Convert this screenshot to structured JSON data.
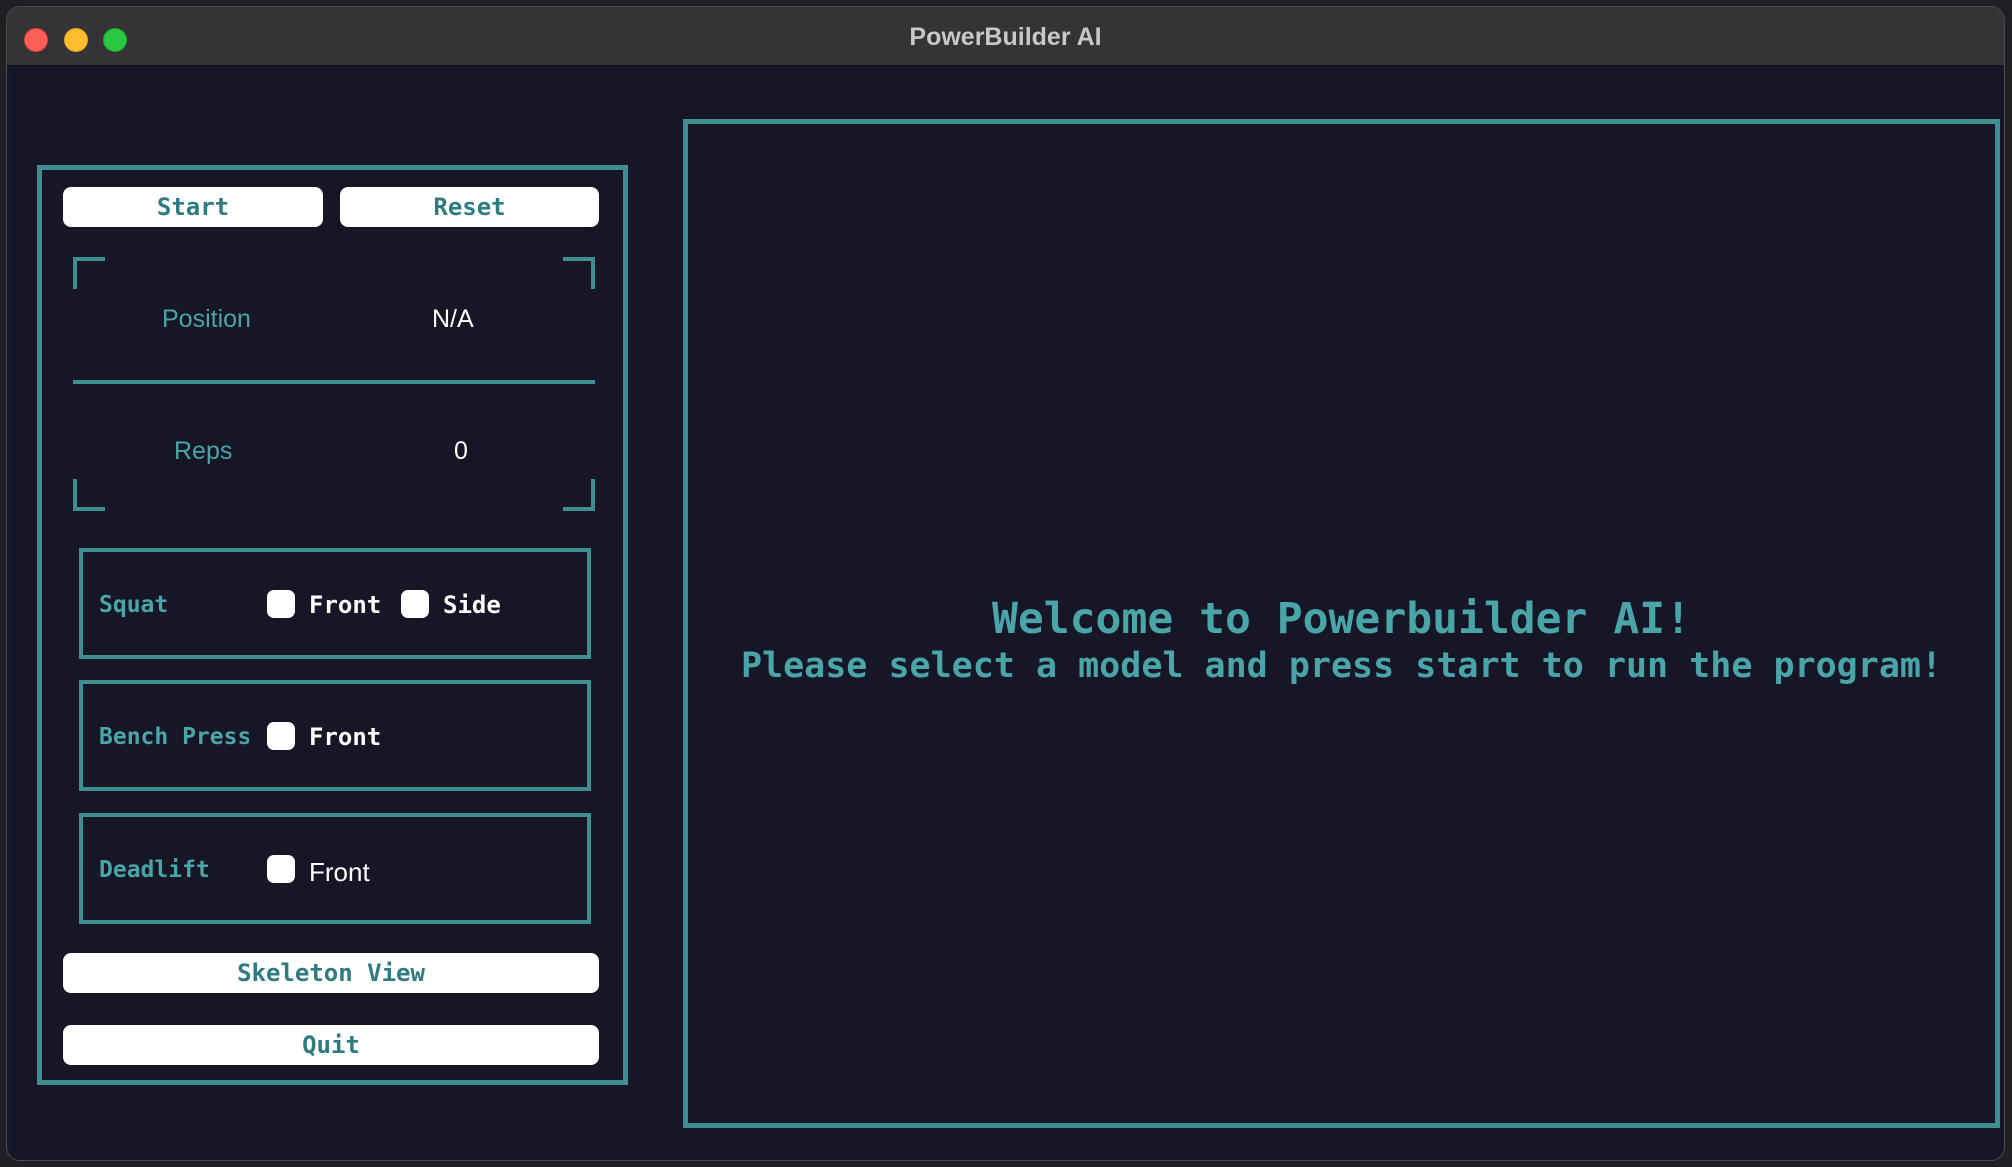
{
  "window": {
    "title": "PowerBuilder AI"
  },
  "controls": {
    "start_label": "Start",
    "reset_label": "Reset",
    "skeleton_label": "Skeleton View",
    "quit_label": "Quit"
  },
  "stats": {
    "position_label": "Position",
    "position_value": "N/A",
    "reps_label": "Reps",
    "reps_value": "0"
  },
  "exercises": {
    "squat": {
      "label": "Squat",
      "front_label": "Front",
      "side_label": "Side",
      "front_checked": false,
      "side_checked": false
    },
    "bench": {
      "label": "Bench Press",
      "front_label": "Front",
      "front_checked": false
    },
    "deadlift": {
      "label": "Deadlift",
      "front_label": "Front",
      "front_checked": false
    }
  },
  "viewport": {
    "heading": "Welcome to Powerbuilder AI!",
    "subheading": "Please select a model and press start to run the program!"
  },
  "colors": {
    "accent": "#3f8f92",
    "accent_text": "#4aa5a8",
    "background": "#161626",
    "button_bg": "#ffffff"
  }
}
